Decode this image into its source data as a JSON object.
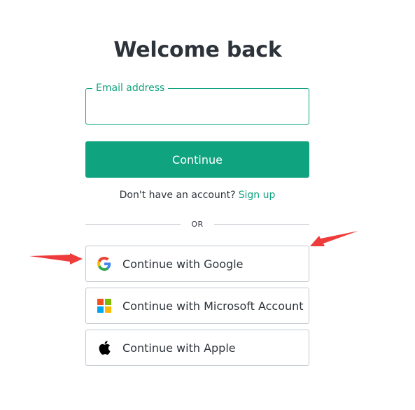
{
  "page": {
    "title": "Welcome back"
  },
  "email": {
    "label": "Email address",
    "value": ""
  },
  "continue_button": {
    "label": "Continue"
  },
  "signup": {
    "prompt": "Don't have an account?",
    "link": "Sign up"
  },
  "divider": {
    "text": "OR"
  },
  "social": [
    {
      "label": "Continue with Google",
      "icon": "google-icon"
    },
    {
      "label": "Continue with Microsoft Account",
      "icon": "microsoft-icon"
    },
    {
      "label": "Continue with Apple",
      "icon": "apple-icon"
    }
  ],
  "colors": {
    "accent": "#10a37f",
    "text": "#2d333a",
    "border": "#c2c8d0",
    "annotation_arrow": "#ee3b3b"
  }
}
